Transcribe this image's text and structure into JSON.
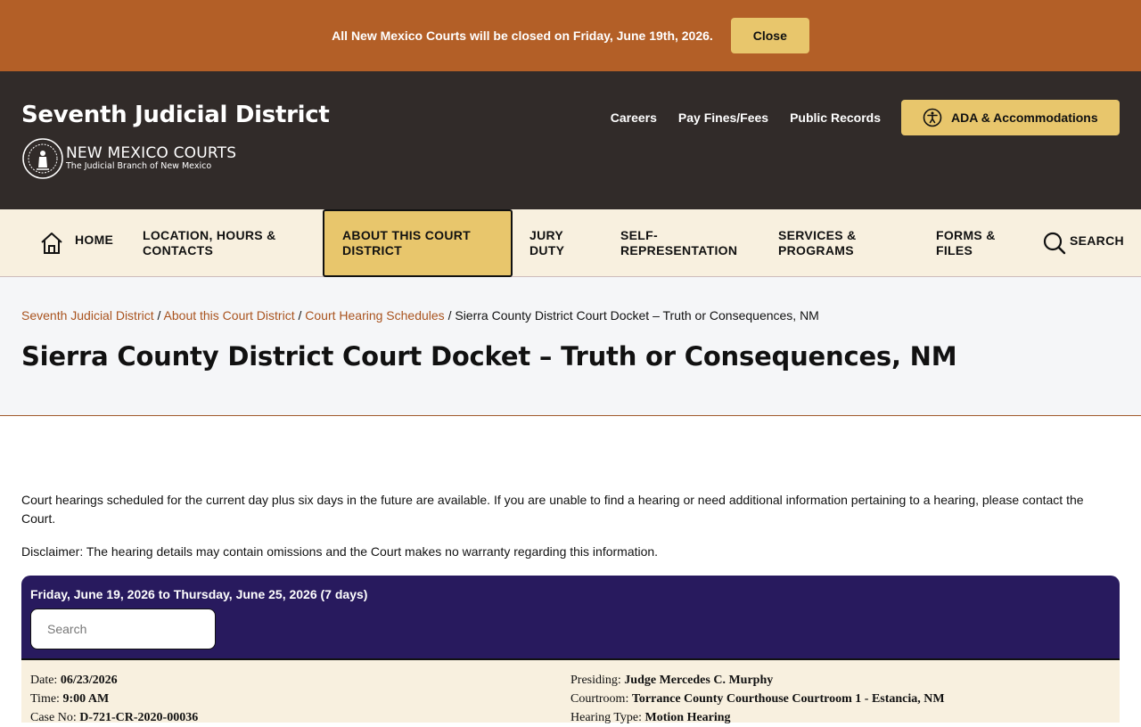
{
  "alert": {
    "message": "All New Mexico Courts will be closed on Friday, June 19th, 2026.",
    "close_label": "Close",
    "background": "#b35f27"
  },
  "header": {
    "site_title": "Seventh Judicial District",
    "logo_name": "NEW MEXICO COURTS",
    "logo_sub": "The Judicial Branch of New Mexico",
    "links": [
      "Careers",
      "Pay Fines/Fees",
      "Public Records"
    ],
    "ada_label": "ADA & Accommodations",
    "accent": "#e8c66c"
  },
  "nav": {
    "home": "HOME",
    "location": "LOCATION, HOURS & CONTACTS",
    "about": "ABOUT THIS COURT DISTRICT",
    "jury": "JURY DUTY",
    "self_rep": "SELF-REPRESENTATION",
    "services": "SERVICES & PROGRAMS",
    "forms": "FORMS & FILES",
    "search": "SEARCH"
  },
  "breadcrumb": {
    "items": [
      "Seventh Judicial District",
      "About this Court District",
      "Court Hearing Schedules"
    ],
    "current": "Sierra County District Court Docket – Truth or Consequences, NM"
  },
  "page_title": "Sierra County District Court Docket – Truth or Consequences, NM",
  "content": {
    "intro": "Court hearings scheduled for the current day plus six days in the future are available. If you are unable to find a hearing or need additional information pertaining to a hearing, please contact the Court.",
    "disclaimer": "Disclaimer:  The hearing details may contain omissions and the Court makes no warranty regarding this information."
  },
  "docket": {
    "date_range": "Friday, June 19, 2026 to Thursday, June 25, 2026 (7 days)",
    "search_placeholder": "Search",
    "header_color": "#281a5e"
  },
  "hearing": {
    "date_label": "Date:",
    "date": "06/23/2026",
    "time_label": "Time:",
    "time": "9:00 AM",
    "case_label": "Case No:",
    "case": "D-721-CR-2020-00036",
    "presiding_label": "Presiding:",
    "presiding": "Judge Mercedes C. Murphy",
    "courtroom_label": "Courtroom:",
    "courtroom": "Torrance County Courthouse Courtroom 1 - Estancia, NM",
    "type_label": "Hearing Type:",
    "type": "Motion Hearing"
  }
}
